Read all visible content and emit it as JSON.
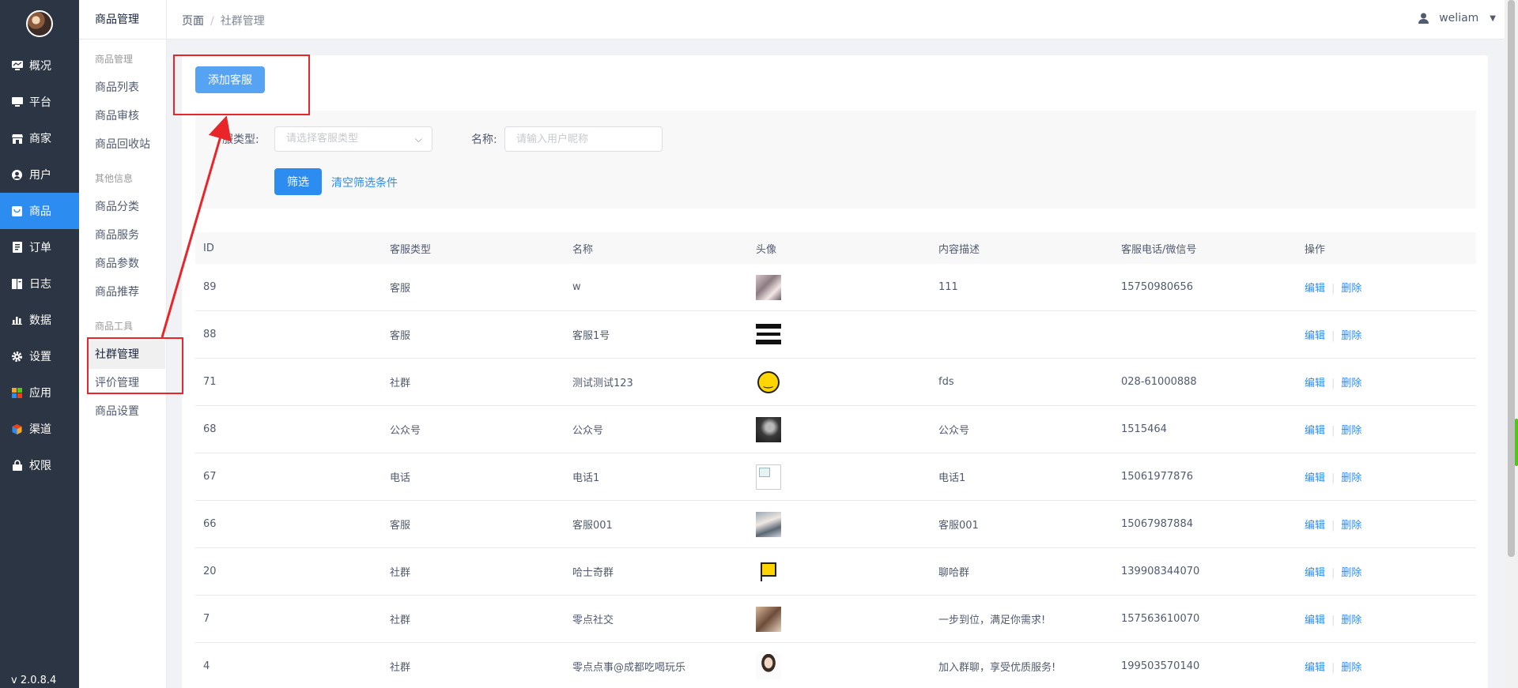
{
  "sidebar": {
    "version": "v 2.0.8.4",
    "items": [
      {
        "label": "概况",
        "icon": "monitor-icon"
      },
      {
        "label": "平台",
        "icon": "desktop-icon"
      },
      {
        "label": "商家",
        "icon": "store-icon"
      },
      {
        "label": "用户",
        "icon": "user-icon"
      },
      {
        "label": "商品",
        "icon": "goods-icon",
        "active": true
      },
      {
        "label": "订单",
        "icon": "order-icon"
      },
      {
        "label": "日志",
        "icon": "log-icon"
      },
      {
        "label": "数据",
        "icon": "chart-icon"
      },
      {
        "label": "设置",
        "icon": "gear-icon"
      },
      {
        "label": "应用",
        "icon": "apps-icon"
      },
      {
        "label": "渠道",
        "icon": "cube-icon"
      },
      {
        "label": "权限",
        "icon": "lock-icon"
      }
    ]
  },
  "subnav": {
    "title": "商品管理",
    "groups": [
      {
        "label": "商品管理",
        "items": [
          "商品列表",
          "商品审核",
          "商品回收站"
        ]
      },
      {
        "label": "其他信息",
        "items": [
          "商品分类",
          "商品服务",
          "商品参数",
          "商品推荐"
        ]
      },
      {
        "label": "商品工具",
        "items": [
          "社群管理",
          "评价管理",
          "商品设置"
        ]
      }
    ],
    "active": "社群管理"
  },
  "header": {
    "breadcrumb": [
      "页面",
      "社群管理"
    ],
    "user": "weliam"
  },
  "toolbar": {
    "add_label": "添加客服"
  },
  "filter": {
    "type_label": "服类型:",
    "type_placeholder": "请选择客服类型",
    "name_label": "名称:",
    "name_placeholder": "请输入用户昵称",
    "submit_label": "筛选",
    "clear_label": "清空筛选条件"
  },
  "table": {
    "columns": [
      "ID",
      "客服类型",
      "名称",
      "头像",
      "内容描述",
      "客服电话/微信号",
      "操作"
    ],
    "edit_label": "编辑",
    "delete_label": "删除",
    "rows": [
      {
        "id": "89",
        "type": "客服",
        "name": "w",
        "avatar": "avatar-photo-icon",
        "desc": "111",
        "contact": "15750980656"
      },
      {
        "id": "88",
        "type": "客服",
        "name": "客服1号",
        "avatar": "avatar-stamp-icon",
        "desc": "",
        "contact": ""
      },
      {
        "id": "71",
        "type": "社群",
        "name": "测试测试123",
        "avatar": "avatar-smiley-icon",
        "desc": "fds",
        "contact": "028-61000888"
      },
      {
        "id": "68",
        "type": "公众号",
        "name": "公众号",
        "avatar": "avatar-photo-icon",
        "desc": "公众号",
        "contact": "1515464"
      },
      {
        "id": "67",
        "type": "电话",
        "name": "电话1",
        "avatar": "broken-image-icon",
        "desc": "电话1",
        "contact": "15061977876"
      },
      {
        "id": "66",
        "type": "客服",
        "name": "客服001",
        "avatar": "avatar-photo-icon",
        "desc": "客服001",
        "contact": "15067987884"
      },
      {
        "id": "20",
        "type": "社群",
        "name": "哈士奇群",
        "avatar": "avatar-flag-icon",
        "desc": "聊哈群",
        "contact": "139908344070"
      },
      {
        "id": "7",
        "type": "社群",
        "name": "零点社交",
        "avatar": "avatar-photo-icon",
        "desc": "一步到位，满足你需求!",
        "contact": "157563610070"
      },
      {
        "id": "4",
        "type": "社群",
        "name": "零点点事@成都吃喝玩乐",
        "avatar": "avatar-photo-icon",
        "desc": "加入群聊，享受优质服务!",
        "contact": "199503570140"
      }
    ]
  },
  "colors": {
    "primary": "#2d8cf0",
    "sidebar_bg": "#2c3543",
    "annotation": "#e8262a"
  }
}
